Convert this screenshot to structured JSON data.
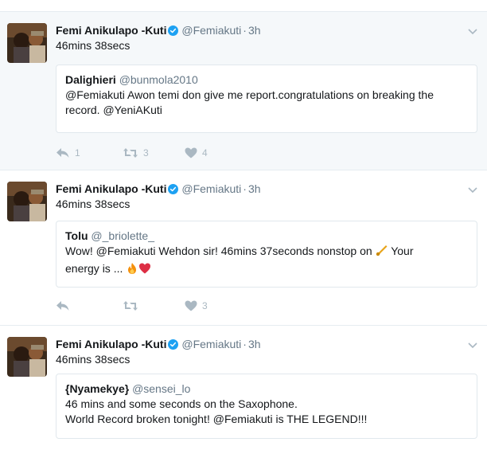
{
  "tweets": [
    {
      "author": "Femi Anikulapo -Kuti",
      "handle": "@Femiakuti",
      "time": "3h",
      "text": "46mins 38secs",
      "quote": {
        "author": "Dalighieri",
        "handle": "@bunmola2010",
        "line1": "@Femiakuti Awon temi don give me report.congratulations on breaking the",
        "line2": "record. @YeniAKuti"
      },
      "replies": "1",
      "retweets": "3",
      "likes": "4"
    },
    {
      "author": "Femi Anikulapo -Kuti",
      "handle": "@Femiakuti",
      "time": "3h",
      "text": "46mins 38secs",
      "quote": {
        "author": "Tolu",
        "handle": "@_briolette_",
        "line1a": "Wow! @Femiakuti Wehdon sir! 46mins 37seconds nonstop on ",
        "line1b": " Your",
        "line2": "energy is ... "
      },
      "replies": "",
      "retweets": "",
      "likes": "3"
    },
    {
      "author": "Femi Anikulapo -Kuti",
      "handle": "@Femiakuti",
      "time": "3h",
      "text": "46mins 38secs",
      "quote": {
        "author": "{Nyamekye}",
        "handle": "@sensei_lo",
        "line1": "46 mins and some seconds on the Saxophone.",
        "line2": "World Record broken tonight! @Femiakuti is THE LEGEND!!!"
      }
    }
  ],
  "separator": "·",
  "colors": {
    "verified": "#1da1f2",
    "muted": "#657786",
    "icon": "#aab8c2",
    "highlight_bg": "#f5f8fa"
  },
  "icons": [
    "verified-badge-icon",
    "reply-icon",
    "retweet-icon",
    "heart-icon",
    "chevron-down-icon",
    "saxophone-emoji",
    "fire-emoji",
    "red-heart-emoji"
  ]
}
